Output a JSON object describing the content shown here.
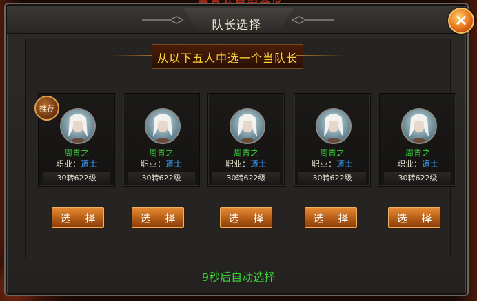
{
  "background": {
    "top_text": "恭喜开启安全区"
  },
  "dialog": {
    "title": "队长选择",
    "close_label": "×",
    "banner": "从以下五人中选一个当队长",
    "recommend_badge": "推荐",
    "select_label": "选 择",
    "countdown": "9秒后自动选择"
  },
  "candidates": [
    {
      "name": "周青之",
      "job_label": "职业：",
      "job": "道士",
      "level": "30转622级"
    },
    {
      "name": "周青之",
      "job_label": "职业：",
      "job": "道士",
      "level": "30转622级"
    },
    {
      "name": "周青之",
      "job_label": "职业：",
      "job": "道士",
      "level": "30转622级"
    },
    {
      "name": "周青之",
      "job_label": "职业：",
      "job": "道士",
      "level": "30转622级"
    },
    {
      "name": "周青之",
      "job_label": "职业：",
      "job": "道士",
      "level": "30转622级"
    }
  ]
}
